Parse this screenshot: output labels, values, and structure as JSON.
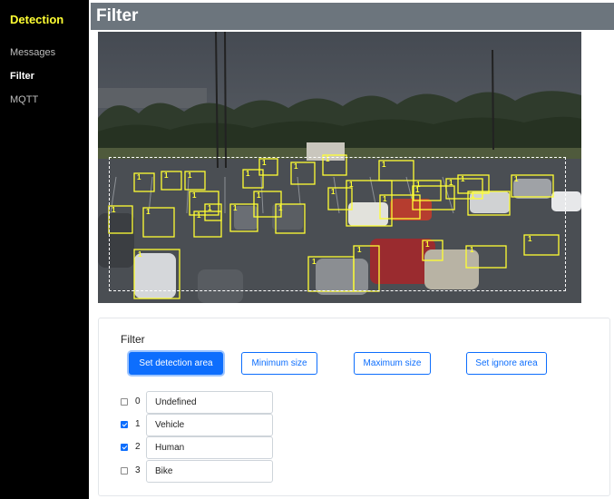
{
  "sidebar": {
    "title": "Detection",
    "items": [
      {
        "label": "Messages",
        "active": false
      },
      {
        "label": "Filter",
        "active": true
      },
      {
        "label": "MQTT",
        "active": false
      }
    ]
  },
  "header": {
    "title": "Filter"
  },
  "camera": {
    "box_color": "#ffff33",
    "boxes": [
      "1",
      "1",
      "1",
      "1",
      "1",
      "1",
      "1",
      "1",
      "1",
      "1",
      "1",
      "1",
      "1",
      "1",
      "1",
      "1",
      "1",
      "1",
      "1",
      "1",
      "1",
      "1",
      "1",
      "1",
      "1",
      "1",
      "1",
      "1",
      "1",
      "1",
      "1"
    ]
  },
  "filter": {
    "title": "Filter",
    "buttons": {
      "set_detection_area": "Set detection area",
      "minimum_size": "Minimum size",
      "maximum_size": "Maximum size",
      "set_ignore_area": "Set ignore area"
    },
    "classes": [
      {
        "id": "0",
        "name": "Undefined",
        "checked": false
      },
      {
        "id": "1",
        "name": "Vehicle",
        "checked": true
      },
      {
        "id": "2",
        "name": "Human",
        "checked": true
      },
      {
        "id": "3",
        "name": "Bike",
        "checked": false
      }
    ]
  },
  "colors": {
    "accent": "#0d6efd",
    "sidebar_bg": "#000000",
    "sidebar_title": "#ffff33",
    "header_bg": "#6c757d"
  }
}
